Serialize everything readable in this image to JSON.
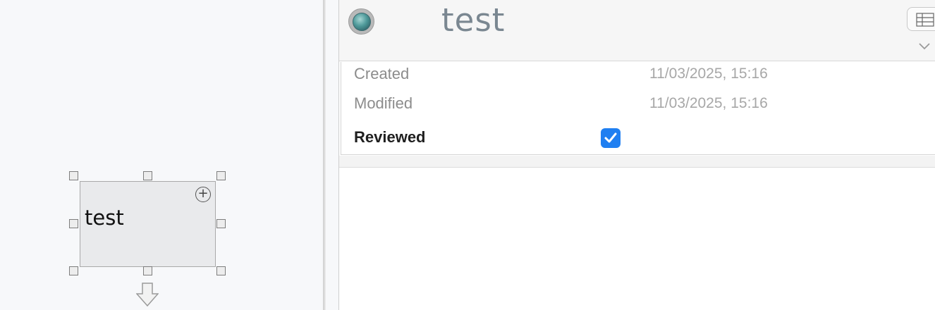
{
  "canvas": {
    "node": {
      "label": "test",
      "add_icon": "plus-circle-icon",
      "expand_icon": "down-arrow-icon"
    }
  },
  "inspector": {
    "title": "test",
    "status_icon": "status-indicator-teal",
    "view_toggle_icon": "table-grid-icon",
    "collapse_icon": "chevron-down-icon",
    "properties": {
      "created_label": "Created",
      "created_value": "11/03/2025, 15:16",
      "modified_label": "Modified",
      "modified_value": "11/03/2025, 15:16",
      "reviewed_label": "Reviewed",
      "reviewed_checked": true
    }
  },
  "colors": {
    "accent": "#1f7ff1",
    "title_text": "#7a8791",
    "status_teal": "#4f9a9a"
  }
}
